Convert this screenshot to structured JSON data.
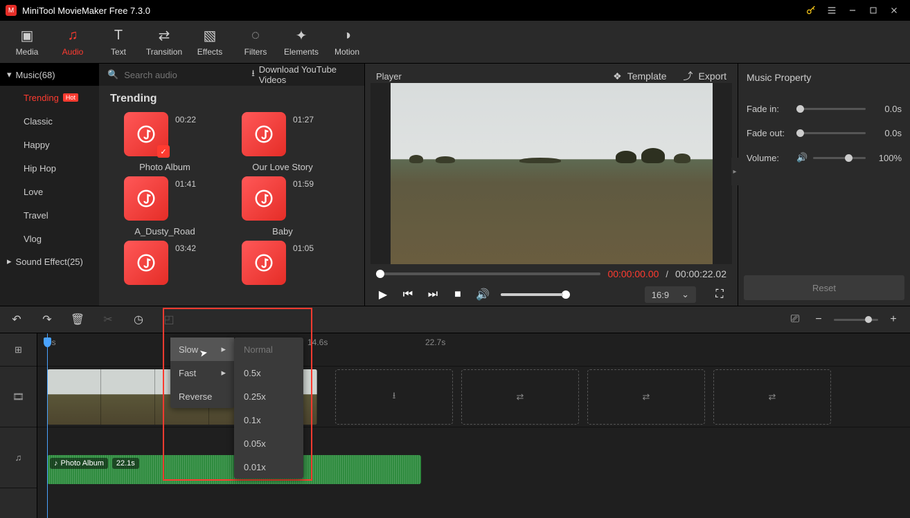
{
  "titlebar": {
    "title": "MiniTool MovieMaker Free 7.3.0"
  },
  "toolbar": {
    "media": "Media",
    "audio": "Audio",
    "text": "Text",
    "transition": "Transition",
    "effects": "Effects",
    "filters": "Filters",
    "elements": "Elements",
    "motion": "Motion"
  },
  "sidebar": {
    "music_header": "Music(68)",
    "items": [
      "Trending",
      "Classic",
      "Happy",
      "Hip Hop",
      "Love",
      "Travel",
      "Vlog"
    ],
    "hot_label": "Hot",
    "sound_effect": "Sound Effect(25)"
  },
  "audio_panel": {
    "search_placeholder": "Search audio",
    "download_label": "Download YouTube Videos",
    "section_title": "Trending",
    "items": [
      {
        "name": "Photo Album",
        "dur": "00:22",
        "checked": true
      },
      {
        "name": "Our Love Story",
        "dur": "01:27",
        "checked": false
      },
      {
        "name": "A_Dusty_Road",
        "dur": "01:41",
        "checked": false
      },
      {
        "name": "Baby",
        "dur": "01:59",
        "checked": false
      },
      {
        "name": "",
        "dur": "03:42",
        "checked": false
      },
      {
        "name": "",
        "dur": "01:05",
        "checked": false
      }
    ]
  },
  "player": {
    "title": "Player",
    "template": "Template",
    "export": "Export",
    "time_current": "00:00:00.00",
    "time_total": "00:00:22.02",
    "ratio": "16:9"
  },
  "props": {
    "title": "Music Property",
    "fade_in_label": "Fade in:",
    "fade_in_val": "0.0s",
    "fade_out_label": "Fade out:",
    "fade_out_val": "0.0s",
    "volume_label": "Volume:",
    "volume_val": "100%",
    "reset": "Reset"
  },
  "timeline": {
    "marks": [
      "0s",
      "14.6s",
      "22.7s"
    ],
    "audio_clip_name": "Photo Album",
    "audio_clip_dur": "22.1s"
  },
  "speed_menu": {
    "slow": "Slow",
    "fast": "Fast",
    "reverse": "Reverse",
    "sub": [
      "Normal",
      "0.5x",
      "0.25x",
      "0.1x",
      "0.05x",
      "0.01x"
    ]
  }
}
